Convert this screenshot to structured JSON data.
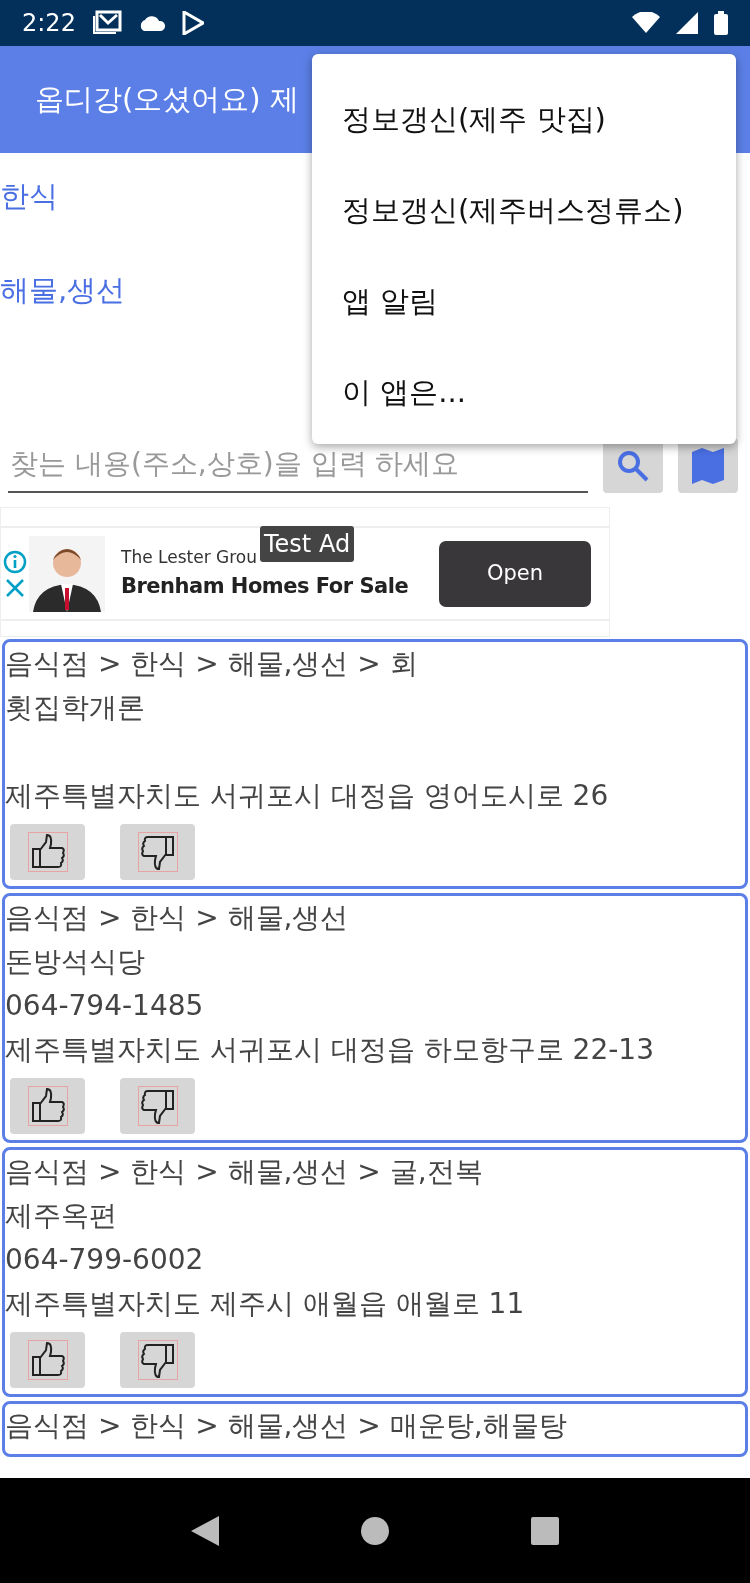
{
  "status_bar": {
    "time": "2:22"
  },
  "app_bar": {
    "title": "옵디강(오셨어요) 제"
  },
  "categories": [
    {
      "label": "한식"
    },
    {
      "label": "해물,생선"
    }
  ],
  "search": {
    "placeholder": "찾는 내용(주소,상호)을 입력 하세요"
  },
  "ad": {
    "badge": "Test Ad",
    "advertiser": "The Lester Grou",
    "headline": "Brenham Homes For Sale",
    "button": "Open"
  },
  "results": [
    {
      "category": "음식점 > 한식 > 해물,생선 > 회",
      "name": "횟집학개론",
      "address": "제주특별자치도 서귀포시 대정읍 영어도시로 26"
    },
    {
      "category": "음식점 > 한식 > 해물,생선",
      "name": "돈방석식당",
      "phone": "064-794-1485",
      "address": "제주특별자치도 서귀포시 대정읍 하모항구로 22-13"
    },
    {
      "category": "음식점 > 한식 > 해물,생선 > 굴,전복",
      "name": "제주옥편",
      "phone": "064-799-6002",
      "address": "제주특별자치도 제주시 애월읍 애월로 11"
    },
    {
      "category": "음식점 > 한식 > 해물,생선 > 매운탕,해물탕"
    }
  ],
  "menu": {
    "items": [
      {
        "label": "정보갱신(제주 맛집)"
      },
      {
        "label": "정보갱신(제주버스정류소)"
      },
      {
        "label": "앱 알림"
      },
      {
        "label": "이 앱은..."
      }
    ]
  }
}
